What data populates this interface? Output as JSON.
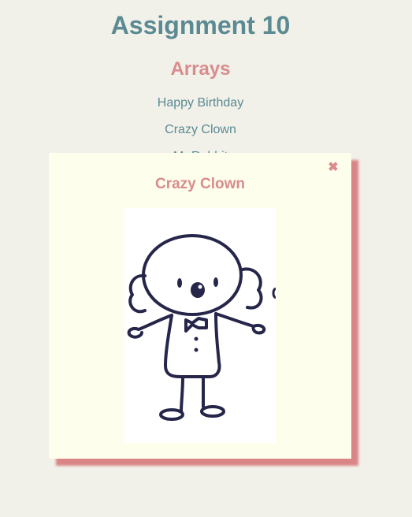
{
  "header": {
    "title": "Assignment 10",
    "subtitle": "Arrays"
  },
  "cards": {
    "items": [
      {
        "label": "Happy Birthday"
      },
      {
        "label": "Crazy Clown"
      },
      {
        "label": "Mr Rabbit"
      }
    ]
  },
  "modal": {
    "title": "Crazy Clown",
    "close_glyph": "✖",
    "image_icon": "clown-icon"
  },
  "colors": {
    "background": "#f1f1ea",
    "heading": "#5b8a92",
    "accent": "#d98c8c",
    "modal_bg": "#fefeec",
    "shadow": "#d98585"
  }
}
